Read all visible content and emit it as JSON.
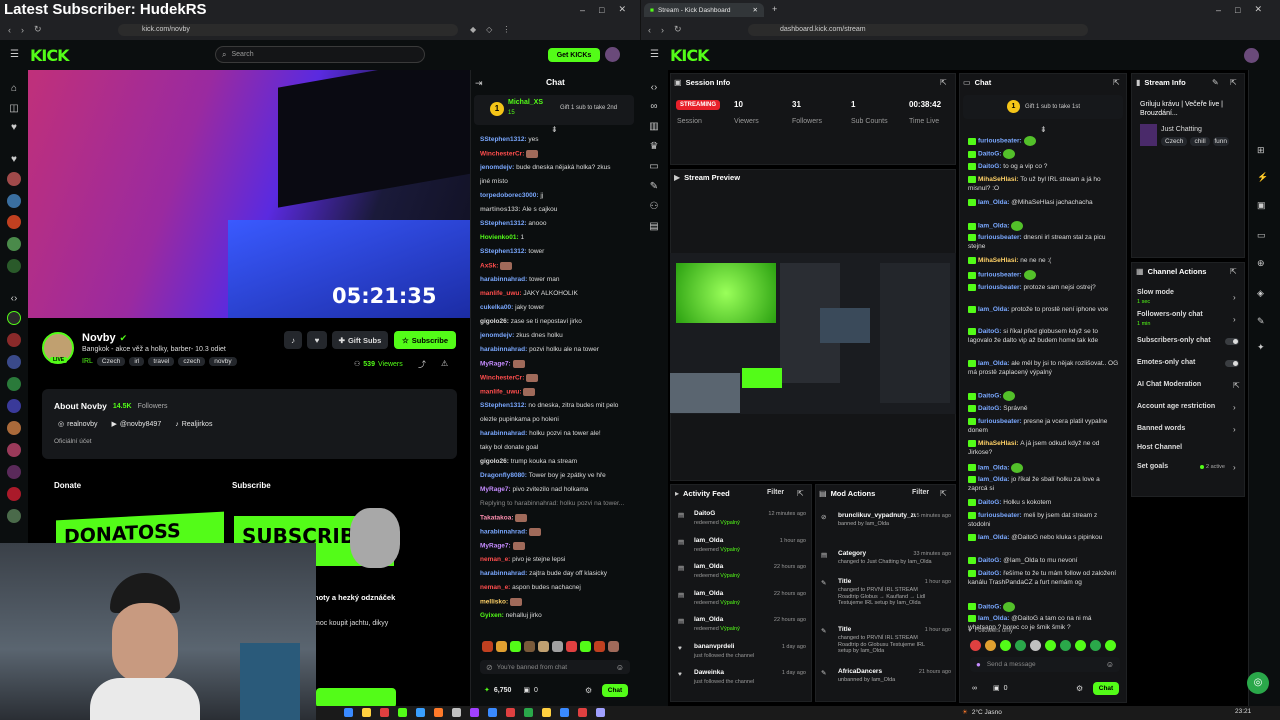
{
  "overlay_title": "Latest Subscriber: HudekRS",
  "left_browser": {
    "url": "kick.com/novby",
    "search_placeholder": "Search",
    "get_kicks": "Get KICKs"
  },
  "stream": {
    "timer": "05:21:35",
    "name": "Novby",
    "title": "Bangkok -  akce věž a holky, barber- 10.3 odiet",
    "category": "IRL",
    "tags": [
      "Czech",
      "irl",
      "travel",
      "czech",
      "novby"
    ],
    "viewers": "539",
    "viewers_label": "Viewers",
    "gift_subs": "Gift Subs",
    "subscribe": "Subscribe"
  },
  "about": {
    "heading": "About Novby",
    "followers": "14.5K",
    "followers_label": "Followers",
    "socials": [
      "realnovby",
      "@novby8497",
      "Realjirkos"
    ],
    "official": "Oficiální účet",
    "donate": "Donate",
    "subscribe": "Subscribe",
    "banner1": "DONATOSS",
    "banner2": "SUBSCRIBE",
    "text1": "noty a hezký odznáček",
    "text2": "moc koupit jachtu, dikyy"
  },
  "left_chat": {
    "title": "Chat",
    "pinned_user": "Michal_XS",
    "pinned_count": "15",
    "pinned_text": "Gift 1 sub to take 2nd",
    "messages": [
      {
        "u": "SStephen1312",
        "c": "#7aa8ff",
        "t": "yes"
      },
      {
        "u": "WinchesterCr",
        "c": "#ff4d4d",
        "t": ""
      },
      {
        "u": "jenomdejv",
        "c": "#7aa8ff",
        "t": "bude dneska nějaká holka? zkus"
      },
      {
        "u": "",
        "c": "#ddd",
        "t": "jiné místo"
      },
      {
        "u": "torpedoborec3000",
        "c": "#7aa8ff",
        "t": "jj"
      },
      {
        "u": "martinos133",
        "c": "#aaa",
        "t": "Ale s cajkou"
      },
      {
        "u": "SStephen1312",
        "c": "#7aa8ff",
        "t": "anooo"
      },
      {
        "u": "Hovienko01",
        "c": "#53fc18",
        "t": "1"
      },
      {
        "u": "SStephen1312",
        "c": "#7aa8ff",
        "t": "tower"
      },
      {
        "u": "AxSk",
        "c": "#ff4d4d",
        "t": ""
      },
      {
        "u": "harabinnahrad",
        "c": "#7aa8ff",
        "t": "tower man"
      },
      {
        "u": "manlife_uwu",
        "c": "#ff4d4d",
        "t": "JAKY ALKOHOLIK"
      },
      {
        "u": "cukelka00",
        "c": "#7aa8ff",
        "t": "jaky tower"
      },
      {
        "u": "gigolo26",
        "c": "#ddd",
        "t": "zase se ti nepostaví jirko"
      },
      {
        "u": "jenomdejv",
        "c": "#7aa8ff",
        "t": "zkus dnes holku"
      },
      {
        "u": "harabinnahrad",
        "c": "#7aa8ff",
        "t": "pozvi holku ale na tower"
      },
      {
        "u": "MyRage7",
        "c": "#c58cff",
        "t": ""
      },
      {
        "u": "WinchesterCr",
        "c": "#ff4d4d",
        "t": ""
      },
      {
        "u": "manlife_uwu",
        "c": "#ff4d4d",
        "t": ""
      },
      {
        "u": "SStephen1312",
        "c": "#7aa8ff",
        "t": "no dneska, zitra budes mit pelo"
      },
      {
        "u": "",
        "c": "#ddd",
        "t": "olezle pupinkama po holeni"
      },
      {
        "u": "harabinnahrad",
        "c": "#7aa8ff",
        "t": "holku pozvi na tower ale!"
      },
      {
        "u": "",
        "c": "#ddd",
        "t": "taky bol donate goal"
      },
      {
        "u": "gigolo26",
        "c": "#ddd",
        "t": "trump kouka na stream"
      },
      {
        "u": "Dragonfly8080",
        "c": "#7aa8ff",
        "t": "Tower boy je zpátky ve hře"
      },
      {
        "u": "MyRage7",
        "c": "#c58cff",
        "t": "pivo zvitezilo nad holkama"
      },
      {
        "u": "",
        "c": "#888",
        "t": "Replying to harabinnahrad: holku pozvi na tower..."
      },
      {
        "u": "Takatakoa",
        "c": "#ff8fb0",
        "t": ""
      },
      {
        "u": "harabinnahrad",
        "c": "#7aa8ff",
        "t": ""
      },
      {
        "u": "MyRage7",
        "c": "#c58cff",
        "t": ""
      },
      {
        "u": "neman_e",
        "c": "#ff4d4d",
        "t": "pivo je stejne lepsi"
      },
      {
        "u": "harabinnahrad",
        "c": "#7aa8ff",
        "t": "zajtra bude day off klasicky"
      },
      {
        "u": "neman_e",
        "c": "#ff4d4d",
        "t": "aspon budes nachacnej"
      },
      {
        "u": "mellisko",
        "c": "#ffd166",
        "t": ""
      },
      {
        "u": "Gyixen",
        "c": "#53fc18",
        "t": "nehalluj jirko"
      }
    ],
    "banned": "You're banned from chat",
    "kicks": "6,750",
    "zero": "0",
    "chat_btn": "Chat"
  },
  "right_browser": {
    "tab": "Stream - Kick Dashboard",
    "url": "dashboard.kick.com/stream"
  },
  "session": {
    "title": "Session Info",
    "status": "STREAMING",
    "status_label": "Session",
    "viewers": "10",
    "viewers_label": "Viewers",
    "followers": "31",
    "followers_label": "Followers",
    "subs": "1",
    "subs_label": "Sub Counts",
    "time": "00:38:42",
    "time_label": "Time Live"
  },
  "preview": {
    "title": "Stream Preview"
  },
  "activity": {
    "title": "Activity Feed",
    "filter": "Filter",
    "items": [
      {
        "u": "DaitoG",
        "a": "redeemed",
        "g": "Výpalný",
        "time": "12 minutes ago"
      },
      {
        "u": "Iam_Olda",
        "a": "redeemed",
        "g": "Výpalný",
        "time": "1 hour ago"
      },
      {
        "u": "Iam_Olda",
        "a": "redeemed",
        "g": "Výpalný",
        "time": "22 hours ago"
      },
      {
        "u": "Iam_Olda",
        "a": "redeemed",
        "g": "Výpalný",
        "time": "22 hours ago"
      },
      {
        "u": "Iam_Olda",
        "a": "redeemed",
        "g": "Výpalný",
        "time": "22 hours ago"
      },
      {
        "u": "bananvprdeli",
        "a": "just followed the channel",
        "g": "",
        "time": "1 day ago"
      },
      {
        "u": "Daweinka",
        "a": "just followed the channel",
        "g": "",
        "time": "1 day ago"
      }
    ]
  },
  "modactions": {
    "title": "Mod Actions",
    "filter": "Filter",
    "items": [
      {
        "t": "brunclikuv_vypadnuty_zub",
        "d": "banned by Iam_Olda",
        "time": "5 minutes ago"
      },
      {
        "t": "Category",
        "d": "changed to Just Chatting by Iam_Olda",
        "time": "33 minutes ago"
      },
      {
        "t": "Title",
        "d": "changed to PRVNÍ IRL STREAM Roadtrip Globus → Kaufland → Lidl Testujeme IRL setup by Iam_Olda",
        "time": "1 hour ago"
      },
      {
        "t": "Title",
        "d": "changed to PRVNÍ IRL STREAM Roadtrip do Globusu Testujeme IRL setup by Iam_Olda",
        "time": "1 hour ago"
      },
      {
        "t": "AfricaDancers",
        "d": "unbanned by Iam_Olda",
        "time": "21 hours ago"
      }
    ]
  },
  "dash_chat": {
    "title": "Chat",
    "pinned": "Gift 1 sub to take 1st",
    "placeholder": "Send a message",
    "followers_only": "Followers only",
    "zero": "0",
    "chat_btn": "Chat",
    "messages": [
      {
        "u": "furiousbeater",
        "c": "#7aa8ff",
        "t": ""
      },
      {
        "u": "DaitoG",
        "c": "#7aa8ff",
        "t": ""
      },
      {
        "u": "DaitoG",
        "c": "#7aa8ff",
        "t": "to og a vip co ?"
      },
      {
        "u": "MihaSeHlasi",
        "c": "#ffd166",
        "t": "To už byl IRL stream a já ho misnul? :O"
      },
      {
        "u": "Iam_Olda",
        "c": "#7aa8ff",
        "t": "@MihaSeHlasi jachachacha"
      },
      {
        "u": "Iam_Olda",
        "c": "#7aa8ff",
        "t": ""
      },
      {
        "u": "furiousbeater",
        "c": "#7aa8ff",
        "t": "dnesni irl stream stal za picu stejne"
      },
      {
        "u": "MihaSeHlasi",
        "c": "#ffd166",
        "t": "ne ne ne :("
      },
      {
        "u": "furiousbeater",
        "c": "#7aa8ff",
        "t": ""
      },
      {
        "u": "furiousbeater",
        "c": "#7aa8ff",
        "t": "protoze sam nejsi ostrej?"
      },
      {
        "u": "Iam_Olda",
        "c": "#7aa8ff",
        "t": "protože to prostě není iphone voe"
      },
      {
        "u": "DaitoG",
        "c": "#7aa8ff",
        "t": "si říkal před globusem když se to lagovalo že dalto vip až budem home tak kde"
      },
      {
        "u": "Iam_Olda",
        "c": "#7aa8ff",
        "t": "ale měl by jsi to nějak rozlišovat.. OG má prostě zaplacený výpalný"
      },
      {
        "u": "DaitoG",
        "c": "#7aa8ff",
        "t": ""
      },
      {
        "u": "DaitoG",
        "c": "#7aa8ff",
        "t": "Správně"
      },
      {
        "u": "furiousbeater",
        "c": "#7aa8ff",
        "t": "presne ja vcera platil vypalne donem"
      },
      {
        "u": "MihaSeHlasi",
        "c": "#ffd166",
        "t": "A já jsem odkud když ne od Jirkose?"
      },
      {
        "u": "Iam_Olda",
        "c": "#7aa8ff",
        "t": ""
      },
      {
        "u": "Iam_Olda",
        "c": "#7aa8ff",
        "t": "jo říkal že sbalí holku za love a zaprcá si"
      },
      {
        "u": "DaitoG",
        "c": "#7aa8ff",
        "t": "Holku s kokotem"
      },
      {
        "u": "furiousbeater",
        "c": "#7aa8ff",
        "t": "meli by jsem dat stream z stodolni"
      },
      {
        "u": "Iam_Olda",
        "c": "#7aa8ff",
        "t": "@DaitoG nebo kluka s pipinkou"
      },
      {
        "u": "DaitoG",
        "c": "#7aa8ff",
        "t": "@Iam_Olda to mu nevoní"
      },
      {
        "u": "DaitoG",
        "c": "#7aa8ff",
        "t": "řešíme to že tu mám follow od založení kanálu TrashPandaCZ a furt nemám og"
      },
      {
        "u": "DaitoG",
        "c": "#7aa8ff",
        "t": ""
      },
      {
        "u": "Iam_Olda",
        "c": "#7aa8ff",
        "t": "@DaitoG a tam co na ni má whatsapp ? borec co je šmik šmik ?"
      }
    ]
  },
  "stream_info": {
    "title": "Stream Info",
    "stream_title": "Griluju krávu | Večeře live | Brouzdání...",
    "category": "Just Chatting",
    "tags": [
      "Czech",
      "chill",
      "funn"
    ]
  },
  "channel_actions": {
    "title": "Channel Actions",
    "slow_mode": "Slow mode",
    "slow_sub": "1 sec",
    "followers_only": "Followers-only chat",
    "followers_sub": "1 min",
    "subs_only": "Subscribers-only chat",
    "emotes_only": "Emotes-only chat",
    "ai": "AI Chat Moderation",
    "age": "Account age restriction",
    "banned_words": "Banned words",
    "host": "Host Channel",
    "goals": "Set goals",
    "goals_active": "2 active"
  },
  "taskbar": {
    "weather": "2°C  Jasno",
    "time": "23:21"
  }
}
